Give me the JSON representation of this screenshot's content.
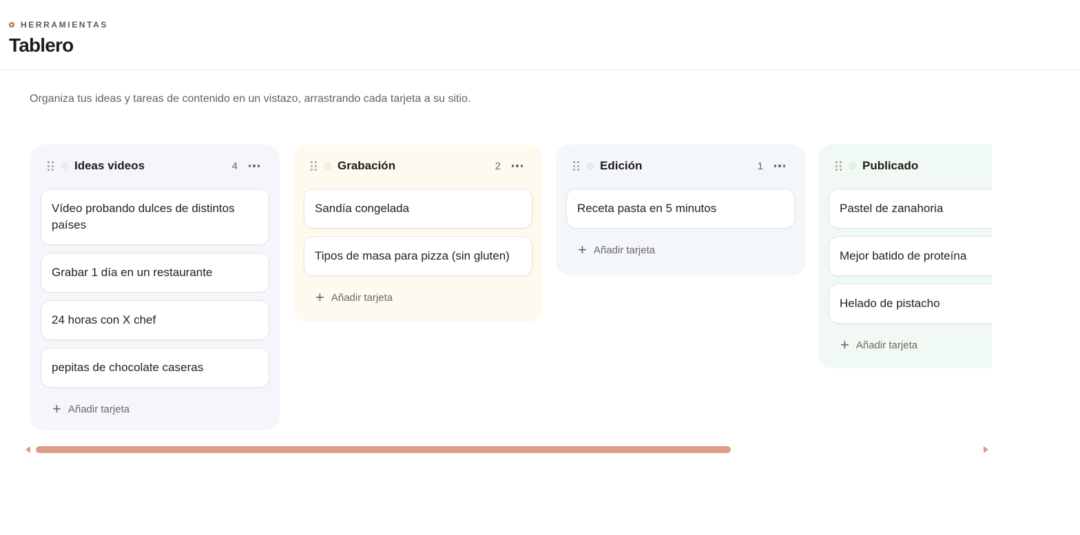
{
  "header": {
    "eyebrow": "HERRAMIENTAS",
    "title": "Tablero"
  },
  "intro": "Organiza tus ideas y tareas de contenido en un vistazo, arrastrando cada tarjeta a su sitio.",
  "add_label": "Añadir tarjeta",
  "colors": {
    "accent": "#de9c86",
    "ideas_bg": "#f5f6fc",
    "grabacion_bg": "#fffaf0",
    "edicion_bg": "#f3f6fb",
    "publicado_bg": "#f0f9f3"
  },
  "columns": [
    {
      "title": "Ideas videos",
      "count": "4",
      "cards": [
        "Vídeo probando dulces de distintos países",
        "Grabar 1 día en un restaurante",
        "24 horas con X chef",
        "pepitas de chocolate caseras"
      ]
    },
    {
      "title": "Grabación",
      "count": "2",
      "cards": [
        "Sandía congelada",
        "Tipos de masa para pizza (sin gluten)"
      ]
    },
    {
      "title": "Edición",
      "count": "1",
      "cards": [
        "Receta pasta en 5 minutos"
      ]
    },
    {
      "title": "Publicado",
      "count": "",
      "cards": [
        "Pastel de zanahoria",
        "Mejor batido de proteína",
        "Helado de pistacho"
      ]
    }
  ],
  "scrollbar": {
    "position_fraction": 0.0,
    "visible_fraction": 0.72
  }
}
